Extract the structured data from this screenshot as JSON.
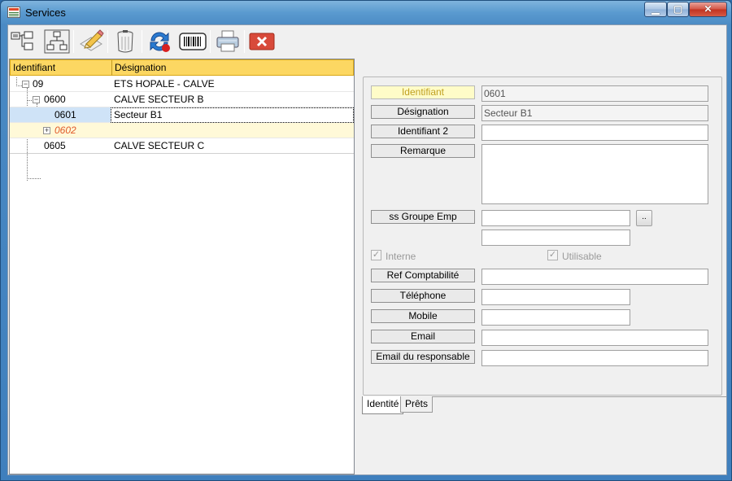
{
  "window": {
    "title": "Services"
  },
  "toolbar": {
    "buttons": [
      {
        "icon": "tree-expand-icon"
      },
      {
        "icon": "tree-structure-icon"
      },
      {
        "icon": "pencil-edit-icon"
      },
      {
        "icon": "trash-bin-icon"
      },
      {
        "icon": "refresh-cancel-icon"
      },
      {
        "icon": "barcode-icon"
      },
      {
        "icon": "printer-icon"
      },
      {
        "icon": "close-icon"
      }
    ]
  },
  "tree": {
    "columns": [
      "Identifiant",
      "Désignation"
    ],
    "rows": [
      {
        "id": "09",
        "designation": "ETS HOPALE - CALVE"
      },
      {
        "id": "0600",
        "designation": "CALVE SECTEUR B"
      },
      {
        "id": "0601",
        "designation": "Secteur B1"
      },
      {
        "id": "0602",
        "designation": ""
      },
      {
        "id": "0605",
        "designation": "CALVE SECTEUR C"
      }
    ]
  },
  "form": {
    "labels": {
      "identifiant": "Identifiant",
      "designation": "Désignation",
      "identifiant2": "Identifiant 2",
      "remarque": "Remarque",
      "ss_groupe": "ss Groupe Emp",
      "interne": "Interne",
      "utilisable": "Utilisable",
      "ref_compta": "Ref Comptabilité",
      "telephone": "Téléphone",
      "mobile": "Mobile",
      "email": "Email",
      "email_resp": "Email du responsable"
    },
    "values": {
      "identifiant": "0601",
      "designation": "Secteur B1",
      "identifiant2": "",
      "remarque": "",
      "ss_groupe": "",
      "ss_groupe_2": "",
      "ref_compta": "",
      "telephone": "",
      "mobile": "",
      "email": "",
      "email_resp": ""
    },
    "browse_label": "..",
    "interne_checked": true,
    "utilisable_checked": true
  },
  "tabs": [
    "Identité",
    "Prêts"
  ],
  "active_tab": "Identité",
  "colors": {
    "header": "#fcd762",
    "selection": "#cfe3f7",
    "new_row": "#fff9d8",
    "new_item_text": "#e05a2a"
  }
}
